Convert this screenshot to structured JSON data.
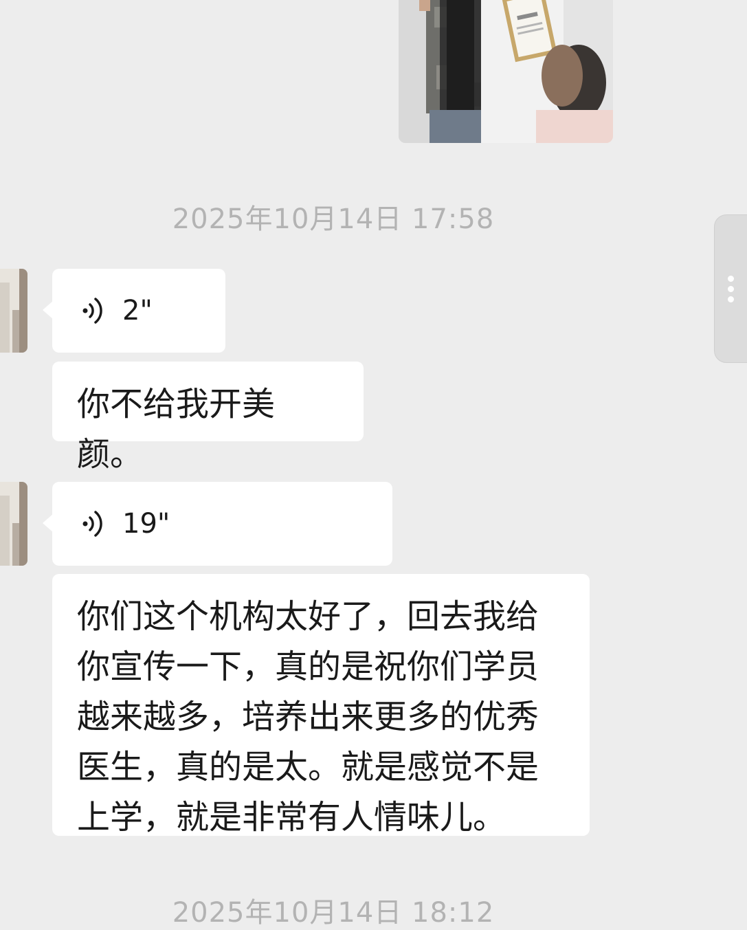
{
  "messages": {
    "timestamp_1": "2025年10月14日 17:58",
    "voice_1_duration": "2\"",
    "text_1": "你不给我开美颜。",
    "voice_2_duration": "19\"",
    "text_2_lines": [
      "你们这个机构太好了，回去我给",
      "你宣传一下，真的是祝你们学员",
      "越来越多，培养出来更多的优秀",
      "医生，真的是太。就是感觉不是",
      "上学，就是非常有人情味儿。"
    ],
    "timestamp_2": "2025年10月14日 18:12"
  },
  "icons": {
    "voice": "voice-wave-icon",
    "more": "more-vertical-icon"
  },
  "colors": {
    "background": "#ededed",
    "bubble": "#ffffff",
    "timestamp": "#b3b3b3",
    "text": "#1a1a1a"
  }
}
